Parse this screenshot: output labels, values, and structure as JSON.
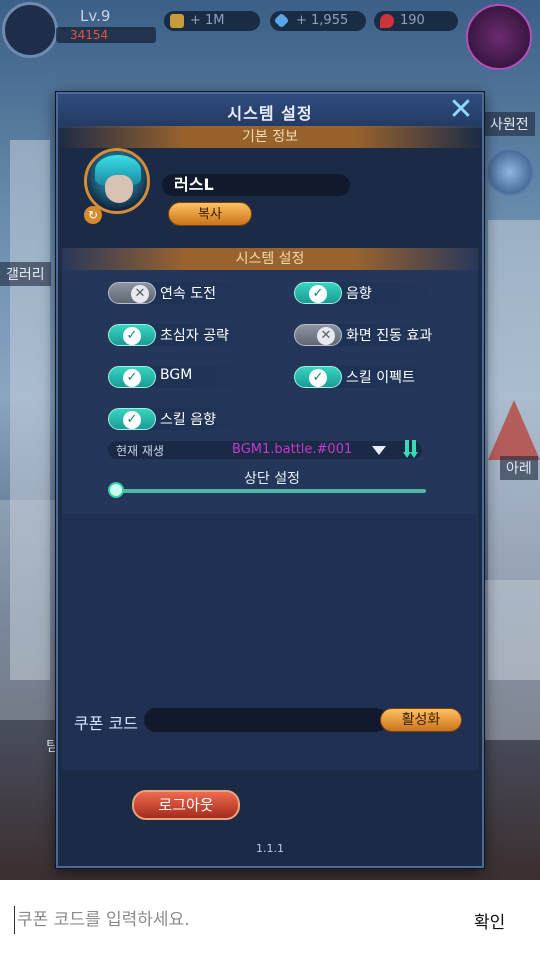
{
  "hud": {
    "level": "Lv.9",
    "power": "34154",
    "gold": "+ 1M",
    "gems": "+ 1,955",
    "ruby": "190"
  },
  "background_labels": {
    "left": "갤러리",
    "right_top": "사원전",
    "right_mid": "아레",
    "left_low": "팀"
  },
  "dialog": {
    "title": "시스템 설정",
    "close_icon": "close-icon",
    "basic_info_header": "기본 정보",
    "player_name": "러스L",
    "copy_label": "복사",
    "system_header": "시스템 설정",
    "toggles": [
      {
        "label": "연속 도전",
        "on": false
      },
      {
        "label": "음향",
        "on": true
      },
      {
        "label": "초심자 공략",
        "on": true
      },
      {
        "label": "화면 진동 효과",
        "on": false
      },
      {
        "label": "BGM",
        "on": true
      },
      {
        "label": "스킬 이펙트",
        "on": true
      },
      {
        "label": "스킬 음향",
        "on": true
      }
    ],
    "now_playing_label": "현재 재생",
    "now_playing_value": "BGM1.battle.#001",
    "volume_title": "상단 설정",
    "volume_level": 0.0,
    "coupon_label": "쿠폰 코드",
    "activate_label": "활성화",
    "logout_label": "로그아웃",
    "version": "1.1.1"
  },
  "input_bar": {
    "placeholder": "쿠폰 코드를 입력하세요.",
    "confirm_label": "확인"
  },
  "colors": {
    "accent_teal": "#37d5c0",
    "accent_orange": "#c9741b",
    "logout_red": "#a42b1c",
    "panel_bg": "#1c2b45",
    "now_playing_text": "#c43acb"
  }
}
